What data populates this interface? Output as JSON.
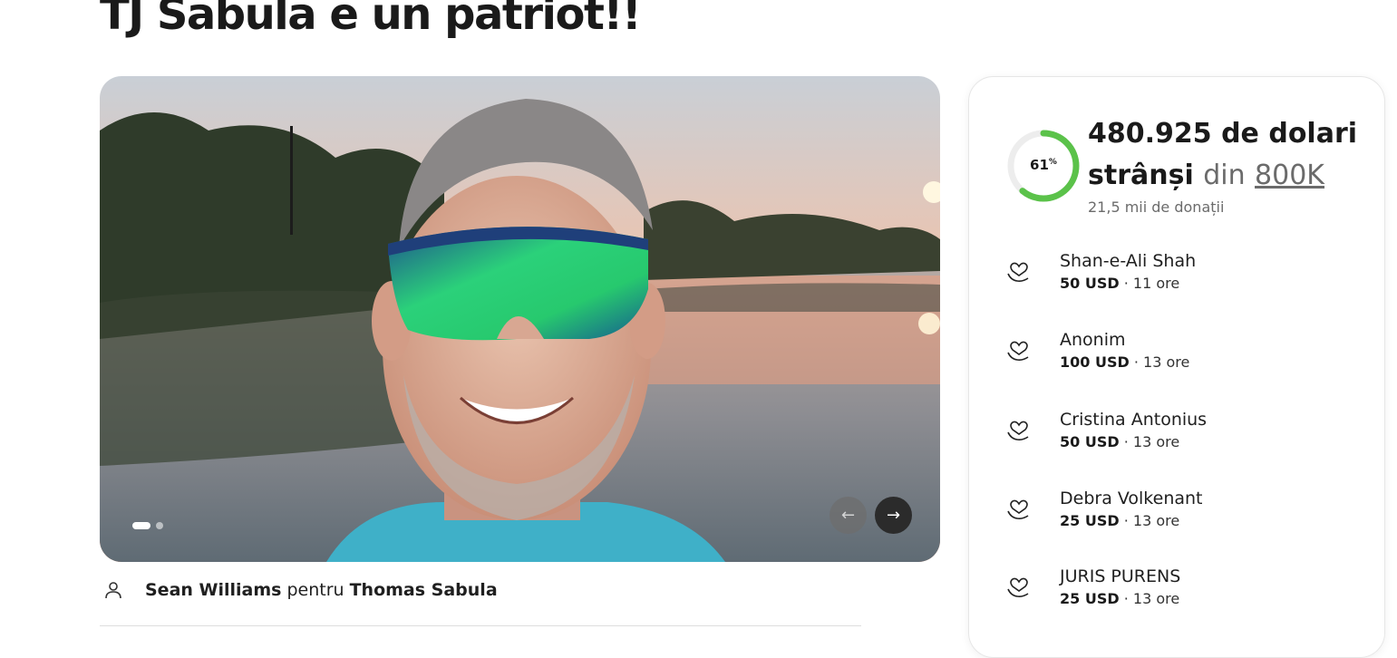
{
  "page": {
    "title": "TJ Sabula e un patriot!!"
  },
  "gallery": {
    "image_alt": "Photo of smiling man wearing green mirrored sunglasses at sunset by a lake",
    "prev_icon": "arrow-left-icon",
    "next_icon": "arrow-right-icon",
    "slide_count": 2,
    "active_slide": 1
  },
  "organizer": {
    "organizer_name": "Sean Williams",
    "connector": "pentru",
    "beneficiary_name": "Thomas Sabula"
  },
  "progress": {
    "percent": 61,
    "percent_number": "61",
    "percent_sign": "%",
    "raised_line1": "480.925 de dolari",
    "raised_line2": "strânși",
    "of_word": "din",
    "goal": "800K",
    "donations_count": "21,5 mii de donații",
    "ring_color": "#5bc24a"
  },
  "donations": [
    {
      "name": "Shan-e-Ali Shah",
      "amount": "50 USD",
      "time": "11 ore"
    },
    {
      "name": "Anonim",
      "amount": "100 USD",
      "time": "13 ore"
    },
    {
      "name": "Cristina Antonius",
      "amount": "50 USD",
      "time": "13 ore"
    },
    {
      "name": "Debra Volkenant",
      "amount": "25 USD",
      "time": "13 ore"
    },
    {
      "name": "JURIS PURENS",
      "amount": "25 USD",
      "time": "13 ore"
    }
  ],
  "separator": "·"
}
